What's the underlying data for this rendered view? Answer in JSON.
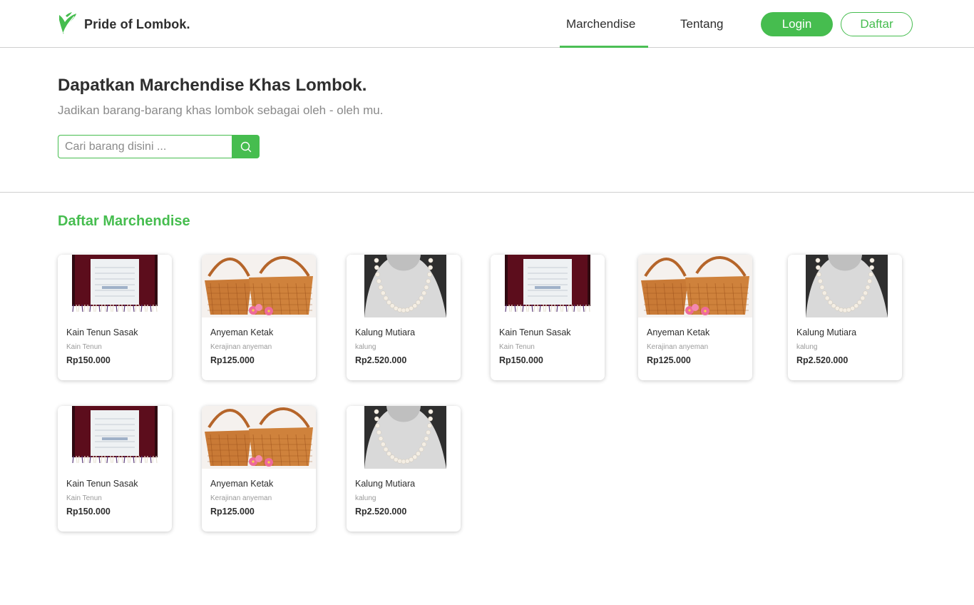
{
  "header": {
    "brand": "Pride of Lombok.",
    "nav": [
      {
        "label": "Marchendise",
        "active": true
      },
      {
        "label": "Tentang",
        "active": false
      }
    ],
    "login_label": "Login",
    "register_label": "Daftar"
  },
  "hero": {
    "title": "Dapatkan Marchendise Khas Lombok.",
    "subtitle": "Jadikan barang-barang khas lombok sebagai oleh - oleh mu.",
    "search_placeholder": "Cari barang disini ..."
  },
  "section": {
    "title": "Daftar Marchendise"
  },
  "products": [
    {
      "name": "Kain Tenun Sasak",
      "category": "Kain Tenun",
      "price": "Rp150.000",
      "image": "woven-cloth"
    },
    {
      "name": "Anyeman Ketak",
      "category": "Kerajinan anyeman",
      "price": "Rp125.000",
      "image": "woven-basket"
    },
    {
      "name": "Kalung Mutiara",
      "category": "kalung",
      "price": "Rp2.520.000",
      "image": "pearl-necklace"
    },
    {
      "name": "Kain Tenun Sasak",
      "category": "Kain Tenun",
      "price": "Rp150.000",
      "image": "woven-cloth"
    },
    {
      "name": "Anyeman Ketak",
      "category": "Kerajinan anyeman",
      "price": "Rp125.000",
      "image": "woven-basket"
    },
    {
      "name": "Kalung Mutiara",
      "category": "kalung",
      "price": "Rp2.520.000",
      "image": "pearl-necklace"
    },
    {
      "name": "Kain Tenun Sasak",
      "category": "Kain Tenun",
      "price": "Rp150.000",
      "image": "woven-cloth"
    },
    {
      "name": "Anyeman Ketak",
      "category": "Kerajinan anyeman",
      "price": "Rp125.000",
      "image": "woven-basket"
    },
    {
      "name": "Kalung Mutiara",
      "category": "kalung",
      "price": "Rp2.520.000",
      "image": "pearl-necklace"
    }
  ],
  "colors": {
    "accent": "#46bd4f",
    "text": "#2e2e2e",
    "muted": "#8a8a8a"
  }
}
